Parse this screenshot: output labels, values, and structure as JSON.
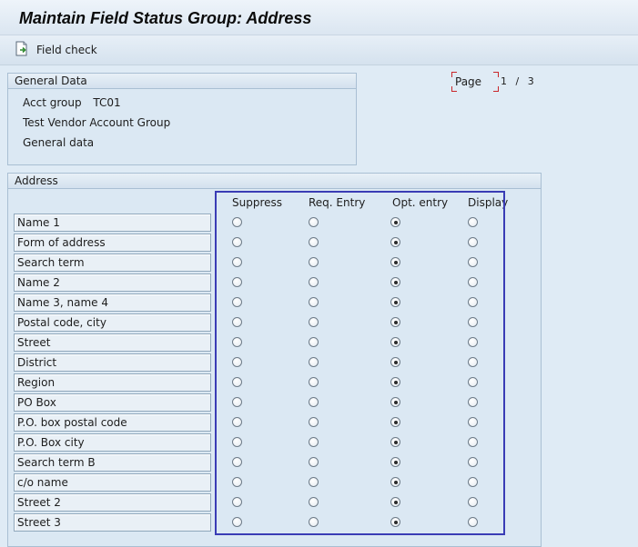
{
  "window": {
    "title": "Maintain Field Status Group: Address"
  },
  "toolbar": {
    "field_check_label": "Field check"
  },
  "general_data": {
    "header": "General Data",
    "acct_group_label": "Acct group",
    "acct_group_value": "TC01",
    "description": "Test Vendor Account Group",
    "subgroup": "General data"
  },
  "paging": {
    "label": "Page",
    "current": "1",
    "separator": "/",
    "total": "3"
  },
  "address": {
    "header": "Address",
    "columns": [
      "Suppress",
      "Req. Entry",
      "Opt. entry",
      "Display"
    ],
    "rows": [
      {
        "label": "Name 1",
        "selected": "Opt. entry"
      },
      {
        "label": "Form of address",
        "selected": "Opt. entry"
      },
      {
        "label": "Search term",
        "selected": "Opt. entry"
      },
      {
        "label": "Name 2",
        "selected": "Opt. entry"
      },
      {
        "label": "Name 3, name 4",
        "selected": "Opt. entry"
      },
      {
        "label": "Postal code, city",
        "selected": "Opt. entry"
      },
      {
        "label": "Street",
        "selected": "Opt. entry"
      },
      {
        "label": "District",
        "selected": "Opt. entry"
      },
      {
        "label": "Region",
        "selected": "Opt. entry"
      },
      {
        "label": "PO Box",
        "selected": "Opt. entry"
      },
      {
        "label": "P.O. box postal code",
        "selected": "Opt. entry"
      },
      {
        "label": "P.O. Box city",
        "selected": "Opt. entry"
      },
      {
        "label": "Search term B",
        "selected": "Opt. entry"
      },
      {
        "label": "c/o name",
        "selected": "Opt. entry"
      },
      {
        "label": "Street 2",
        "selected": "Opt. entry"
      },
      {
        "label": "Street 3",
        "selected": "Opt. entry"
      }
    ]
  },
  "colors": {
    "highlight": "#3a3cb5",
    "page_marker": "#c9262a"
  },
  "icons": {
    "field_check": "document-arrow-icon"
  }
}
